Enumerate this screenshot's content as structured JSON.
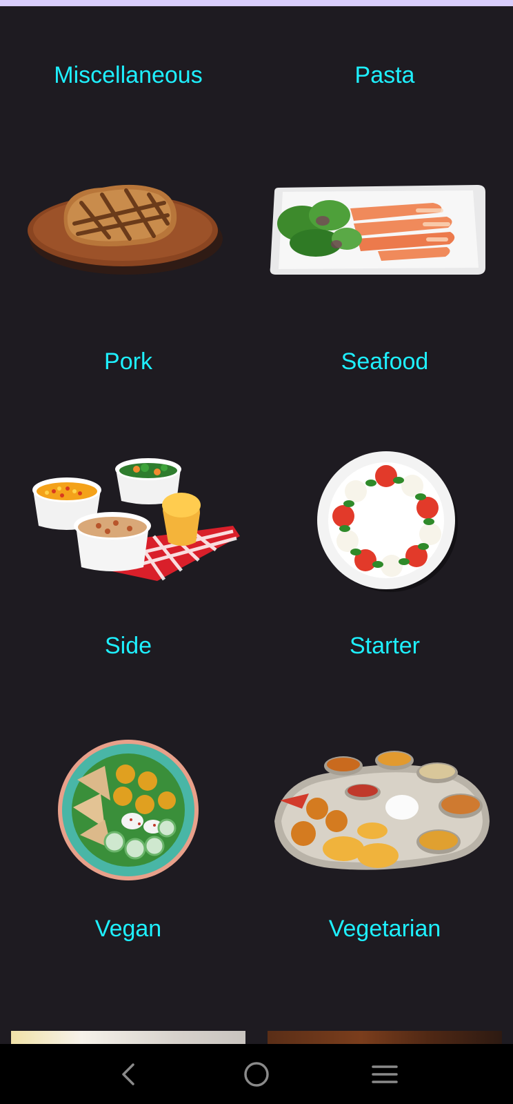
{
  "categories": [
    {
      "label": "Miscellaneous"
    },
    {
      "label": "Pasta"
    },
    {
      "label": "Pork"
    },
    {
      "label": "Seafood"
    },
    {
      "label": "Side"
    },
    {
      "label": "Starter"
    },
    {
      "label": "Vegan"
    },
    {
      "label": "Vegetarian"
    }
  ],
  "images": {
    "pork": "pork-steak-image",
    "seafood": "salmon-plate-image",
    "side": "side-dishes-image",
    "starter": "caprese-plate-image",
    "vegan": "vegan-bowl-image",
    "vegetarian": "thali-platter-image"
  },
  "nav": {
    "back": "back-icon",
    "home": "home-icon",
    "menu": "menu-icon"
  },
  "colors": {
    "background": "#1e1b21",
    "label": "#1ef0ff",
    "status_strip": "#d9cdfc",
    "navbar": "#000000"
  }
}
